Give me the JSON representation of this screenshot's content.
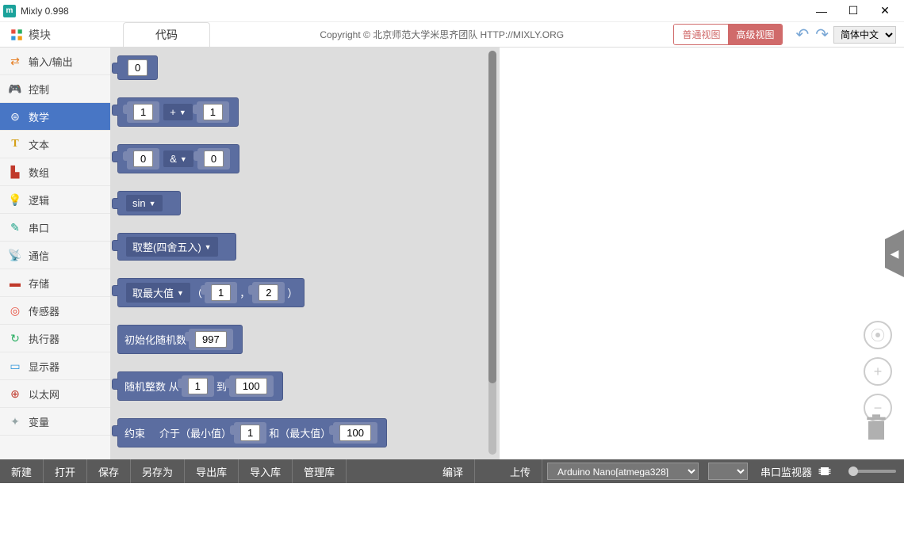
{
  "window": {
    "title": "Mixly 0.998",
    "app_icon_letter": "m"
  },
  "top": {
    "module_label": "模块",
    "code_tab": "代码",
    "copyright": "Copyright © 北京师范大学米思齐团队 HTTP://MIXLY.ORG",
    "view_normal": "普通视图",
    "view_advanced": "高级视图",
    "language": "简体中文"
  },
  "sidebar": {
    "items": [
      {
        "label": "输入/输出",
        "icon": "⇄",
        "class": "icon-io"
      },
      {
        "label": "控制",
        "icon": "🎮",
        "class": "icon-ctrl"
      },
      {
        "label": "数学",
        "icon": "⊜",
        "class": "icon-math",
        "active": true
      },
      {
        "label": "文本",
        "icon": "T",
        "class": "icon-text"
      },
      {
        "label": "数组",
        "icon": "▙",
        "class": "icon-array"
      },
      {
        "label": "逻辑",
        "icon": "💡",
        "class": "icon-logic"
      },
      {
        "label": "串口",
        "icon": "✎",
        "class": "icon-serial"
      },
      {
        "label": "通信",
        "icon": "📡",
        "class": "icon-comm"
      },
      {
        "label": "存储",
        "icon": "▬",
        "class": "icon-storage"
      },
      {
        "label": "传感器",
        "icon": "◎",
        "class": "icon-sensor"
      },
      {
        "label": "执行器",
        "icon": "↻",
        "class": "icon-actuator"
      },
      {
        "label": "显示器",
        "icon": "▭",
        "class": "icon-display"
      },
      {
        "label": "以太网",
        "icon": "⊕",
        "class": "icon-ethernet"
      },
      {
        "label": "变量",
        "icon": "✦",
        "class": "icon-var"
      }
    ]
  },
  "blocks": {
    "const0": "0",
    "add": {
      "a": "1",
      "op": "+",
      "b": "1"
    },
    "bitand": {
      "a": "0",
      "op": "&",
      "b": "0"
    },
    "sin": "sin",
    "round": "取整(四舍五入)",
    "max": {
      "label": "取最大值",
      "a": "1",
      "b": "2"
    },
    "randseed": {
      "label": "初始化随机数",
      "val": "997"
    },
    "randint": {
      "label1": "随机整数 从",
      "a": "1",
      "label2": "到",
      "b": "100"
    },
    "constrain": {
      "label1": "约束",
      "label2": "介于（最小值）",
      "a": "1",
      "label3": "和（最大值）",
      "b": "100"
    }
  },
  "bottom": {
    "new": "新建",
    "open": "打开",
    "save": "保存",
    "saveas": "另存为",
    "export": "导出库",
    "import": "导入库",
    "manage": "管理库",
    "compile": "编译",
    "upload": "上传",
    "board": "Arduino Nano[atmega328]",
    "serial_monitor": "串口监视器"
  }
}
